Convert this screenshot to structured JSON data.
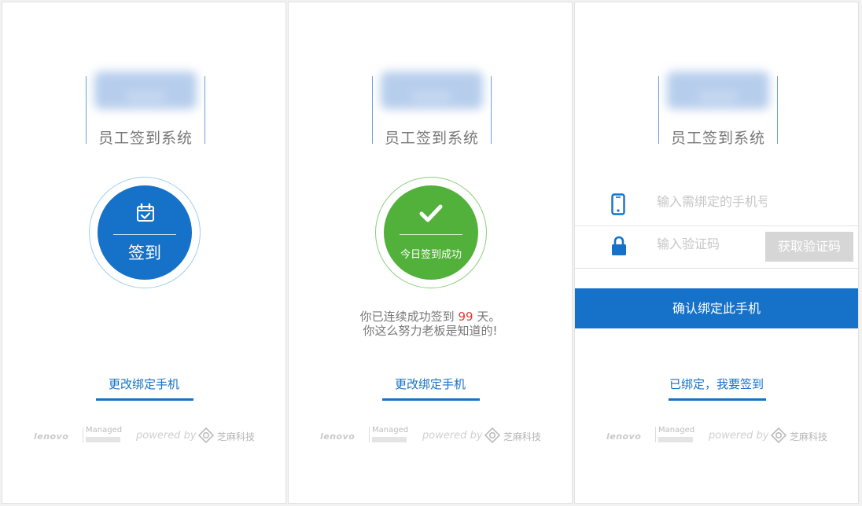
{
  "system_title": "员工签到系统",
  "panel1": {
    "checkin_label": "签到",
    "change_phone_link": "更改绑定手机"
  },
  "panel2": {
    "success_label": "今日签到成功",
    "streak_prefix": "你已连续成功签到 ",
    "streak_days": "99",
    "streak_suffix": " 天。",
    "streak_line2": "你这么努力老板是知道的!",
    "change_phone_link": "更改绑定手机"
  },
  "panel3": {
    "phone_placeholder": "输入需绑定的手机号码",
    "code_placeholder": "输入验证码",
    "get_code_button": "获取验证码",
    "confirm_button": "确认绑定此手机",
    "bound_link": "已绑定，我要签到"
  },
  "footer": {
    "lenovo": "lenovo",
    "managed": "Managed",
    "powered_by": "powered by",
    "company": "芝麻科技"
  },
  "icons": {
    "checkin": "calendar-check-icon",
    "success": "checkmark-icon",
    "phone": "mobile-phone-icon",
    "code": "lock-icon",
    "company_logo": "zhima-logo-icon"
  },
  "colors": {
    "primary": "#1671c8",
    "success": "#52b13a",
    "streak_highlight": "#e53935",
    "disabled_button": "#d6d6d6"
  }
}
